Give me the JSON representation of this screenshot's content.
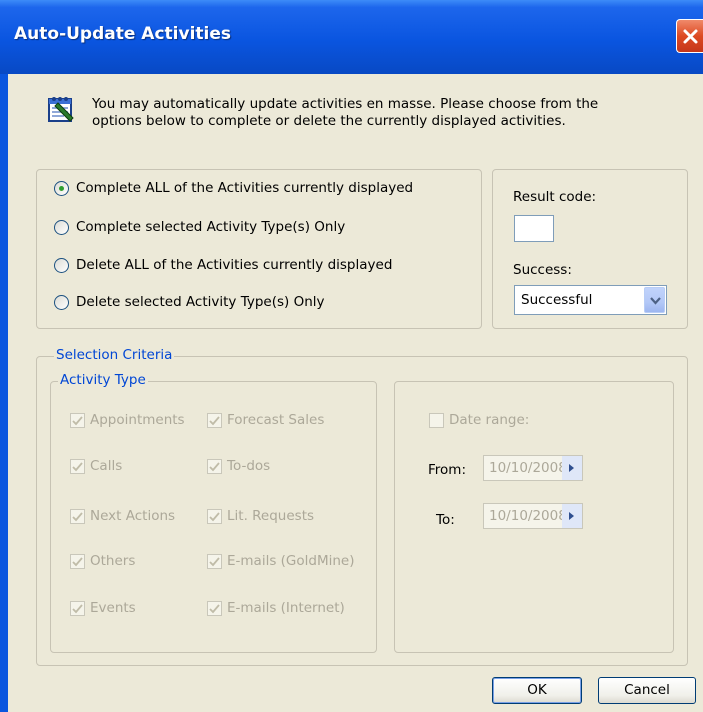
{
  "window": {
    "title": "Auto-Update Activities",
    "close_icon": "close-x-icon"
  },
  "message": {
    "icon": "activity-update-icon",
    "text": "You may automatically update activities en masse.  Please choose from the options below to complete or delete the currently displayed activities."
  },
  "actions": {
    "selected_index": 0,
    "options": [
      "Complete ALL of the Activities currently displayed",
      "Complete selected Activity Type(s) Only",
      "Delete ALL of the Activities currently displayed",
      "Delete selected Activity Type(s) Only"
    ]
  },
  "result": {
    "result_code_label": "Result code:",
    "result_code_value": "",
    "success_label": "Success:",
    "success_value": "Successful"
  },
  "selection_criteria": {
    "legend": "Selection Criteria",
    "activity_type": {
      "legend": "Activity Type",
      "left_column": [
        "Appointments",
        "Calls",
        "Next Actions",
        "Others",
        "Events"
      ],
      "right_column": [
        "Forecast Sales",
        "To-dos",
        "Lit. Requests",
        "E-mails (GoldMine)",
        "E-mails (Internet)"
      ],
      "all_checked": true,
      "enabled": false
    },
    "date": {
      "date_range_label": "Date range:",
      "date_range_checked": false,
      "from_label": "From:",
      "from_value": "10/10/2008",
      "to_label": "To:",
      "to_value": "10/10/2008"
    }
  },
  "buttons": {
    "ok": "OK",
    "cancel": "Cancel"
  },
  "colors": {
    "titlebar": "#0a55e0",
    "dialog_bg": "#ece9d8",
    "legend_text": "#0046d5",
    "disabled_text": "#aca899"
  }
}
